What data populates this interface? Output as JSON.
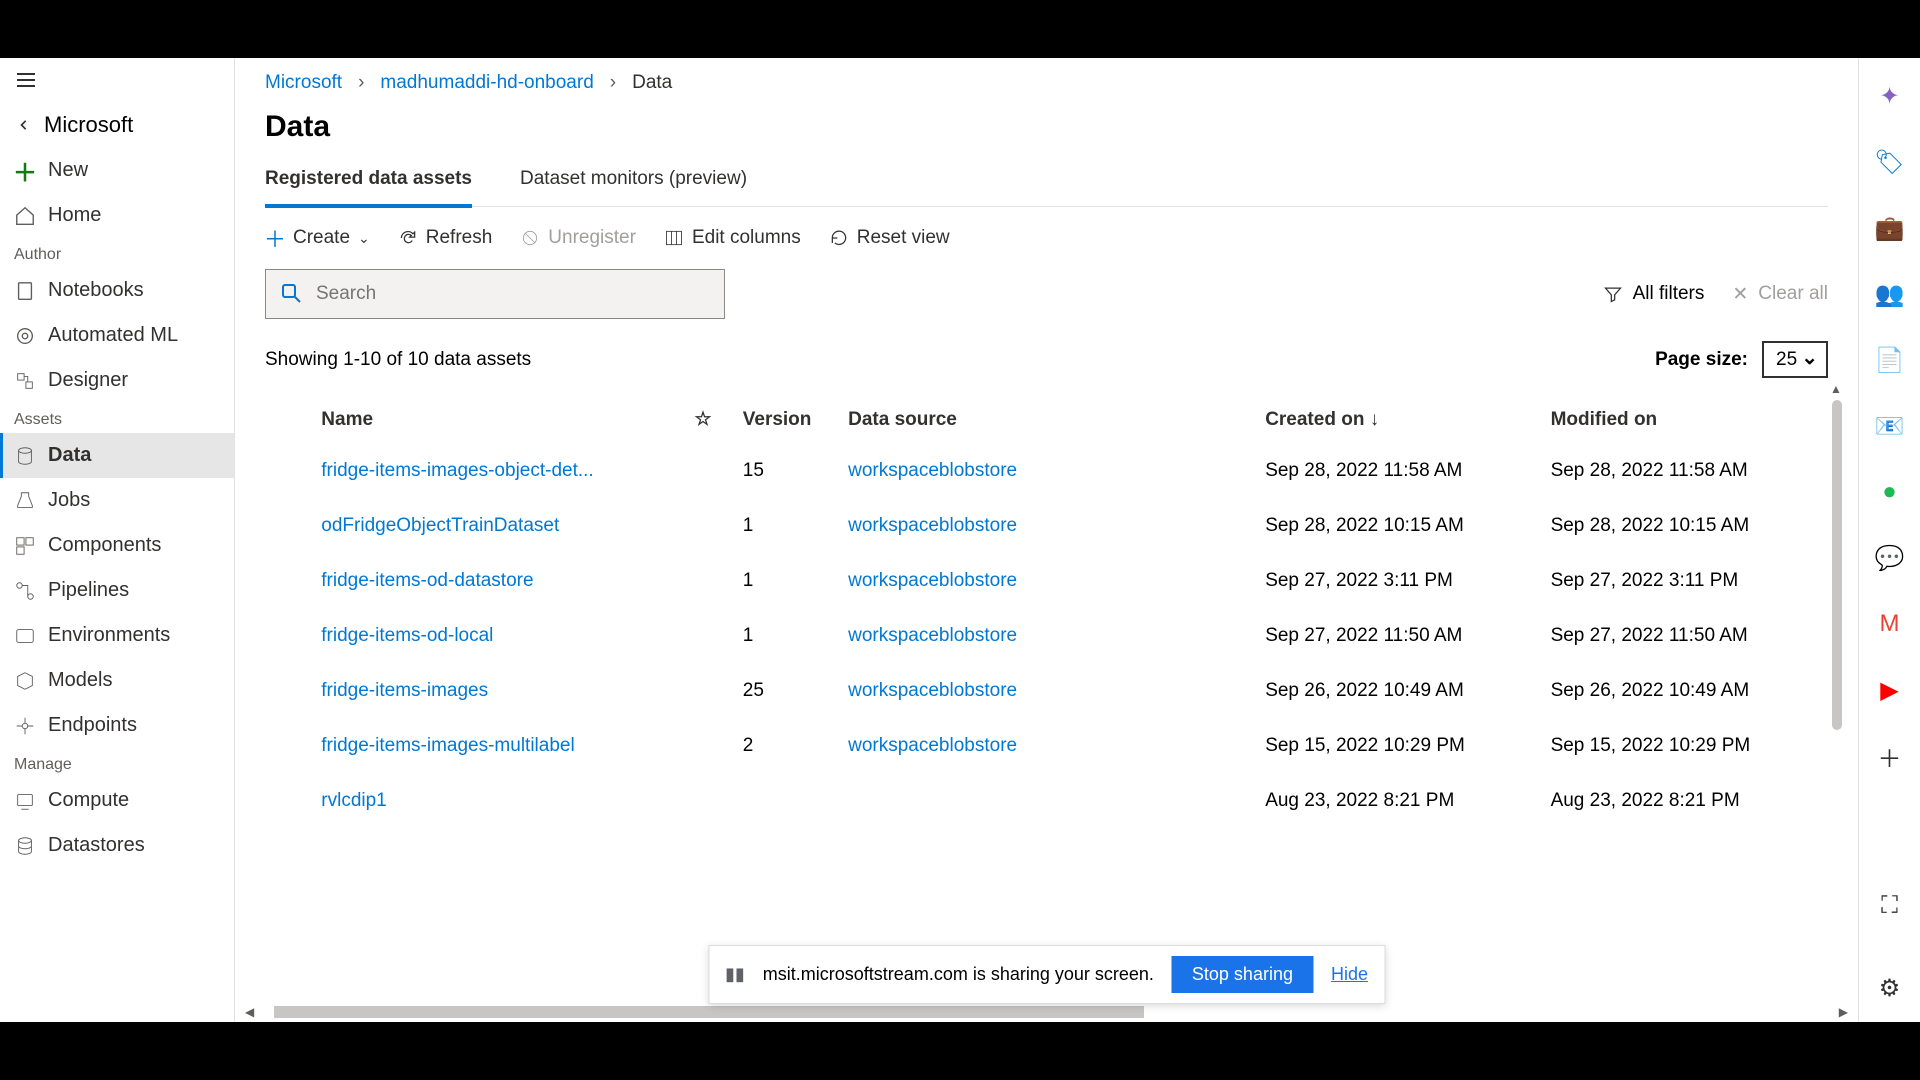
{
  "workspace_name": "Microsoft",
  "sidebar": {
    "new": "New",
    "home": "Home",
    "sections": {
      "author": "Author",
      "assets": "Assets",
      "manage": "Manage"
    },
    "items": {
      "notebooks": "Notebooks",
      "automl": "Automated ML",
      "designer": "Designer",
      "data": "Data",
      "jobs": "Jobs",
      "components": "Components",
      "pipelines": "Pipelines",
      "environments": "Environments",
      "models": "Models",
      "endpoints": "Endpoints",
      "compute": "Compute",
      "datastores": "Datastores"
    }
  },
  "breadcrumb": {
    "root": "Microsoft",
    "workspace": "madhumaddi-hd-onboard",
    "current": "Data"
  },
  "page_title": "Data",
  "tabs": {
    "registered": "Registered data assets",
    "monitors": "Dataset monitors (preview)"
  },
  "toolbar": {
    "create": "Create",
    "refresh": "Refresh",
    "unregister": "Unregister",
    "edit_columns": "Edit columns",
    "reset_view": "Reset view"
  },
  "search": {
    "placeholder": "Search"
  },
  "filters": {
    "all": "All filters",
    "clear": "Clear all"
  },
  "status_text": "Showing 1-10 of 10 data assets",
  "page_size": {
    "label": "Page size:",
    "value": "25"
  },
  "columns": {
    "name": "Name",
    "version": "Version",
    "data_source": "Data source",
    "created": "Created on",
    "modified": "Modified on"
  },
  "rows": [
    {
      "name": "fridge-items-images-object-det...",
      "version": "15",
      "source": "workspaceblobstore",
      "created": "Sep 28, 2022 11:58 AM",
      "modified": "Sep 28, 2022 11:58 AM"
    },
    {
      "name": "odFridgeObjectTrainDataset",
      "version": "1",
      "source": "workspaceblobstore",
      "created": "Sep 28, 2022 10:15 AM",
      "modified": "Sep 28, 2022 10:15 AM"
    },
    {
      "name": "fridge-items-od-datastore",
      "version": "1",
      "source": "workspaceblobstore",
      "created": "Sep 27, 2022 3:11 PM",
      "modified": "Sep 27, 2022 3:11 PM"
    },
    {
      "name": "fridge-items-od-local",
      "version": "1",
      "source": "workspaceblobstore",
      "created": "Sep 27, 2022 11:50 AM",
      "modified": "Sep 27, 2022 11:50 AM"
    },
    {
      "name": "fridge-items-images",
      "version": "25",
      "source": "workspaceblobstore",
      "created": "Sep 26, 2022 10:49 AM",
      "modified": "Sep 26, 2022 10:49 AM"
    },
    {
      "name": "fridge-items-images-multilabel",
      "version": "2",
      "source": "workspaceblobstore",
      "created": "Sep 15, 2022 10:29 PM",
      "modified": "Sep 15, 2022 10:29 PM"
    },
    {
      "name": "rvlcdip1",
      "version": "",
      "source": "",
      "created": "Aug 23, 2022 8:21 PM",
      "modified": "Aug 23, 2022 8:21 PM"
    }
  ],
  "share_bar": {
    "text": "msit.microsoftstream.com is sharing your screen.",
    "stop": "Stop sharing",
    "hide": "Hide"
  }
}
